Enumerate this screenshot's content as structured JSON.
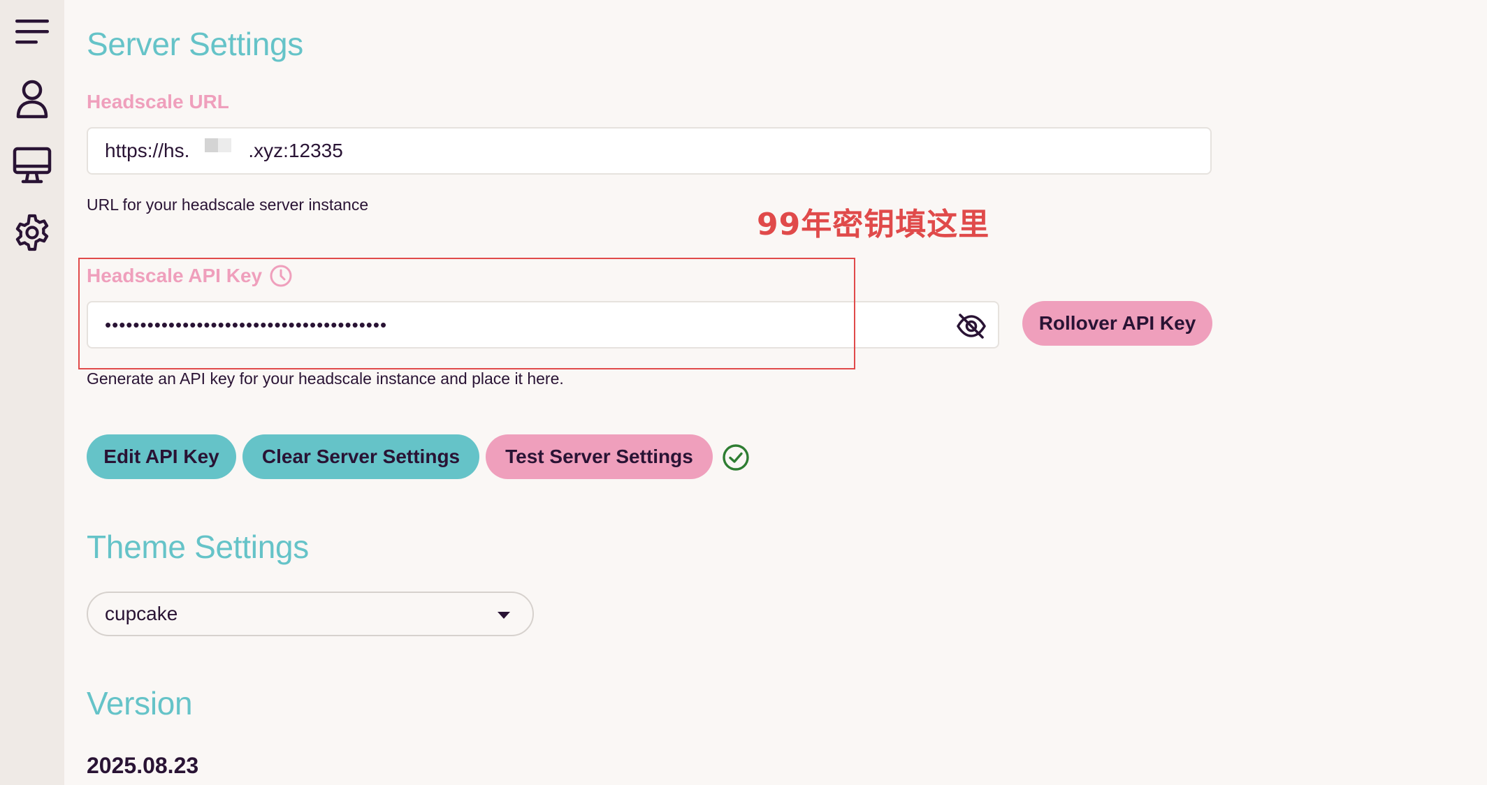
{
  "sidebar": {
    "items": [
      {
        "name": "menu-icon"
      },
      {
        "name": "user-icon"
      },
      {
        "name": "monitor-icon"
      },
      {
        "name": "gear-icon"
      }
    ]
  },
  "server_settings": {
    "title": "Server Settings",
    "url": {
      "label": "Headscale URL",
      "value_prefix": "https://hs.",
      "value_suffix": ".xyz:12335",
      "help": "URL for your headscale server instance"
    },
    "api_key": {
      "label": "Headscale API Key",
      "value": "••••••••••••••••••••••••••••••••••••••••",
      "help": "Generate an API key for your headscale instance and place it here.",
      "rollover_label": "Rollover API Key"
    },
    "buttons": {
      "edit": "Edit API Key",
      "clear": "Clear Server Settings",
      "test": "Test Server Settings"
    }
  },
  "theme_settings": {
    "title": "Theme Settings",
    "selected": "cupcake"
  },
  "version": {
    "title": "Version",
    "value": "2025.08.23"
  },
  "annotation": {
    "text": "99年密钥填这里"
  },
  "colors": {
    "primary": "#65c3c8",
    "secondary": "#ef9fbc",
    "text": "#291334",
    "success": "#2e7d32",
    "annotation": "#e04a4a"
  }
}
